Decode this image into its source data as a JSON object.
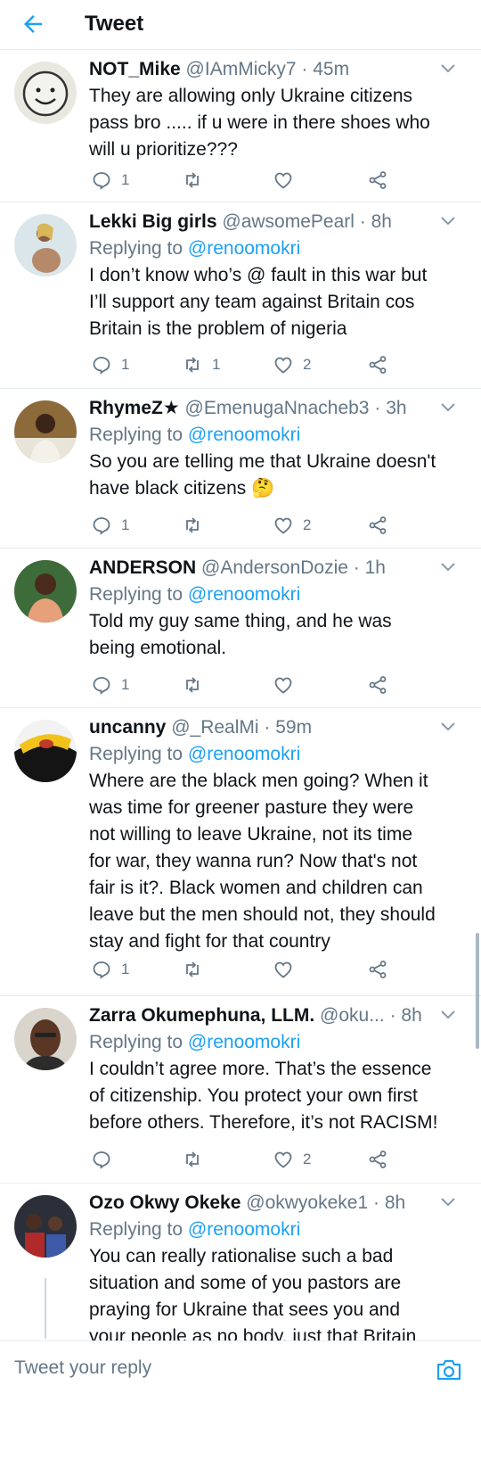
{
  "header": {
    "title": "Tweet"
  },
  "tweets": [
    {
      "name": "NOT_Mike",
      "handle": "@IAmMicky7",
      "time": "45m",
      "replying_label": "",
      "replying_to": "",
      "lines": [
        "They are allowing only Ukraine citizens",
        "pass bro ..... if u were in there shoes who",
        "will u prioritize???"
      ],
      "replies": "1",
      "retweets": "",
      "likes": ""
    },
    {
      "name": "Lekki Big girls",
      "handle": "@awsomePearl",
      "time": "8h",
      "replying_label": "Replying to",
      "replying_to": "@renoomokri",
      "lines": [
        "I don’t know who’s @ fault in this war but",
        "I’ll support any team against Britain cos",
        "Britain is the problem of nigeria"
      ],
      "replies": "1",
      "retweets": "1",
      "likes": "2"
    },
    {
      "name": "RhymeZ★",
      "handle": "@EmenugaNnacheb3",
      "time": "3h",
      "replying_label": "Replying to",
      "replying_to": "@renoomokri",
      "lines": [
        "So you are telling me that Ukraine doesn't",
        "have black citizens 🤔"
      ],
      "replies": "1",
      "retweets": "",
      "likes": "2"
    },
    {
      "name": "ANDERSON",
      "handle": "@AndersonDozie",
      "time": "1h",
      "replying_label": "Replying to",
      "replying_to": "@renoomokri",
      "lines": [
        "Told my guy same thing, and he was",
        "being emotional."
      ],
      "replies": "1",
      "retweets": "",
      "likes": ""
    },
    {
      "name": "uncanny",
      "handle": "@_RealMi",
      "time": "59m",
      "replying_label": "Replying to",
      "replying_to": "@renoomokri",
      "lines": [
        "Where are the black men going? When it",
        "was time for greener pasture they were",
        "not willing to leave Ukraine, not its time",
        "for war, they wanna run? Now that's not",
        "fair is it?. Black women and children can",
        "leave but the men should not, they should",
        "stay and fight for that country"
      ],
      "replies": "1",
      "retweets": "",
      "likes": ""
    },
    {
      "name": "Zarra Okumephuna, LLM.",
      "handle": "@oku...",
      "time": "8h",
      "replying_label": "Replying to",
      "replying_to": "@renoomokri",
      "lines": [
        "I couldn’t agree more. That’s the essence",
        "of citizenship. You protect your own first",
        "before others. Therefore, it’s not RACISM!"
      ],
      "replies": "",
      "retweets": "",
      "likes": "2"
    },
    {
      "name": "Ozo Okwy Okeke",
      "handle": "@okwyokeke1",
      "time": "8h",
      "replying_label": "Replying to",
      "replying_to": "@renoomokri",
      "lines": [
        "You can really rationalise such a bad",
        "situation and some of you pastors are",
        "praying for Ukraine that sees you and",
        "your people as no body, just that Britain"
      ],
      "replies": "",
      "retweets": "",
      "likes": ""
    }
  ],
  "composer": {
    "placeholder": "Tweet your reply"
  },
  "colors": {
    "accent": "#1da1f2",
    "muted": "#657786",
    "text": "#0f1419",
    "divider": "#e6ecf0"
  },
  "icons": [
    "back-arrow-icon",
    "chevron-down-icon",
    "reply-icon",
    "retweet-icon",
    "like-icon",
    "share-icon",
    "camera-icon"
  ]
}
